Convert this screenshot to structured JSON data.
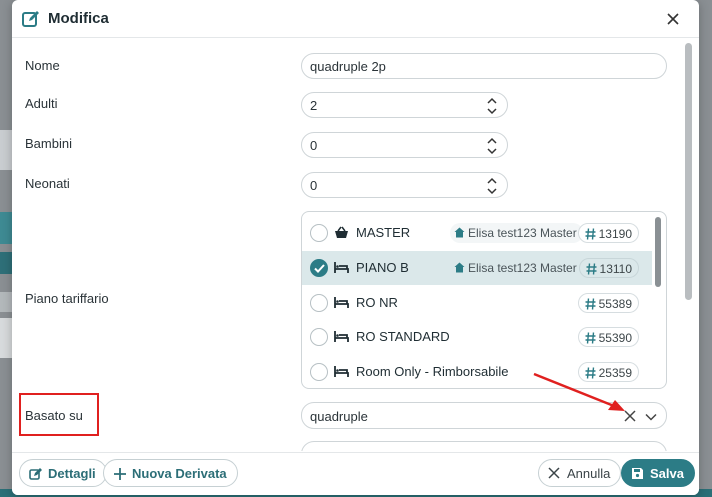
{
  "modal": {
    "title": "Modifica"
  },
  "form": {
    "nome": {
      "label": "Nome",
      "value": "quadruple 2p"
    },
    "adulti": {
      "label": "Adulti",
      "value": "2"
    },
    "bambini": {
      "label": "Bambini",
      "value": "0"
    },
    "neonati": {
      "label": "Neonati",
      "value": "0"
    },
    "piano_tariffario": {
      "label": "Piano tariffario",
      "options": [
        {
          "name": "MASTER",
          "icon": "basket-icon",
          "master": "Elisa test123 Master",
          "id": "13190",
          "selected": false
        },
        {
          "name": "PIANO B",
          "icon": "bed-icon",
          "master": "Elisa test123 Master",
          "id": "13110",
          "selected": true
        },
        {
          "name": "RO NR",
          "icon": "bed-icon",
          "master": "",
          "id": "55389",
          "selected": false
        },
        {
          "name": "RO STANDARD",
          "icon": "bed-icon",
          "master": "",
          "id": "55390",
          "selected": false
        },
        {
          "name": "Room Only - Rimborsabile",
          "icon": "bed-icon",
          "master": "",
          "id": "25359",
          "selected": false
        }
      ]
    },
    "basato_su": {
      "label": "Basato su",
      "value": "quadruple"
    }
  },
  "footer": {
    "dettagli": "Dettagli",
    "nuova_derivata": "Nuova Derivata",
    "annulla": "Annulla",
    "salva": "Salva"
  },
  "colors": {
    "accent": "#2c7c86",
    "annotation": "#e0201f"
  }
}
